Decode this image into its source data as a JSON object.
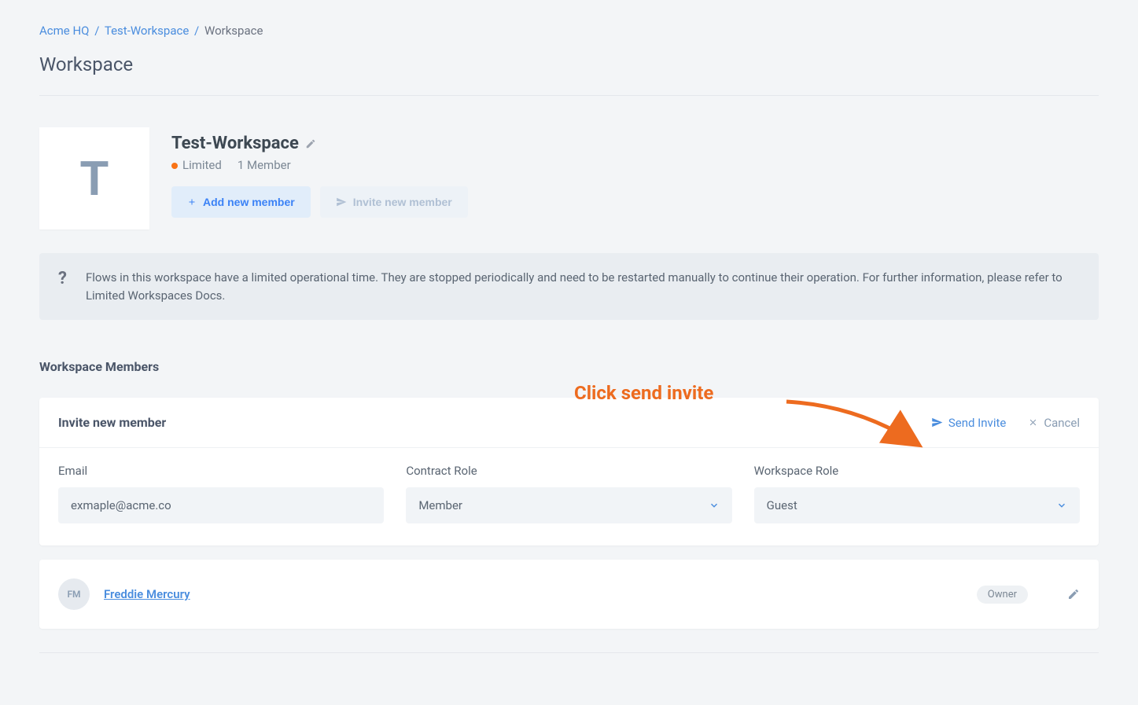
{
  "breadcrumb": {
    "org": "Acme HQ",
    "workspace": "Test-Workspace",
    "current": "Workspace"
  },
  "page_title": "Workspace",
  "workspace": {
    "initial": "T",
    "name": "Test-Workspace",
    "status_label": "Limited",
    "member_count_label": "1 Member"
  },
  "actions": {
    "add_member": "Add new member",
    "invite_member": "Invite new member"
  },
  "banner": {
    "text": "Flows in this workspace have a limited operational time. They are stopped periodically and need to be restarted manually to continue their operation. For further information, please refer to Limited Workspaces Docs."
  },
  "members_section_title": "Workspace Members",
  "annotation": "Click send invite",
  "invite_form": {
    "title": "Invite new member",
    "send_label": "Send Invite",
    "cancel_label": "Cancel",
    "email_label": "Email",
    "email_value": "exmaple@acme.co",
    "contract_role_label": "Contract Role",
    "contract_role_value": "Member",
    "workspace_role_label": "Workspace Role",
    "workspace_role_value": "Guest"
  },
  "members": [
    {
      "initials": "FM",
      "name": "Freddie Mercury",
      "role": "Owner"
    }
  ]
}
